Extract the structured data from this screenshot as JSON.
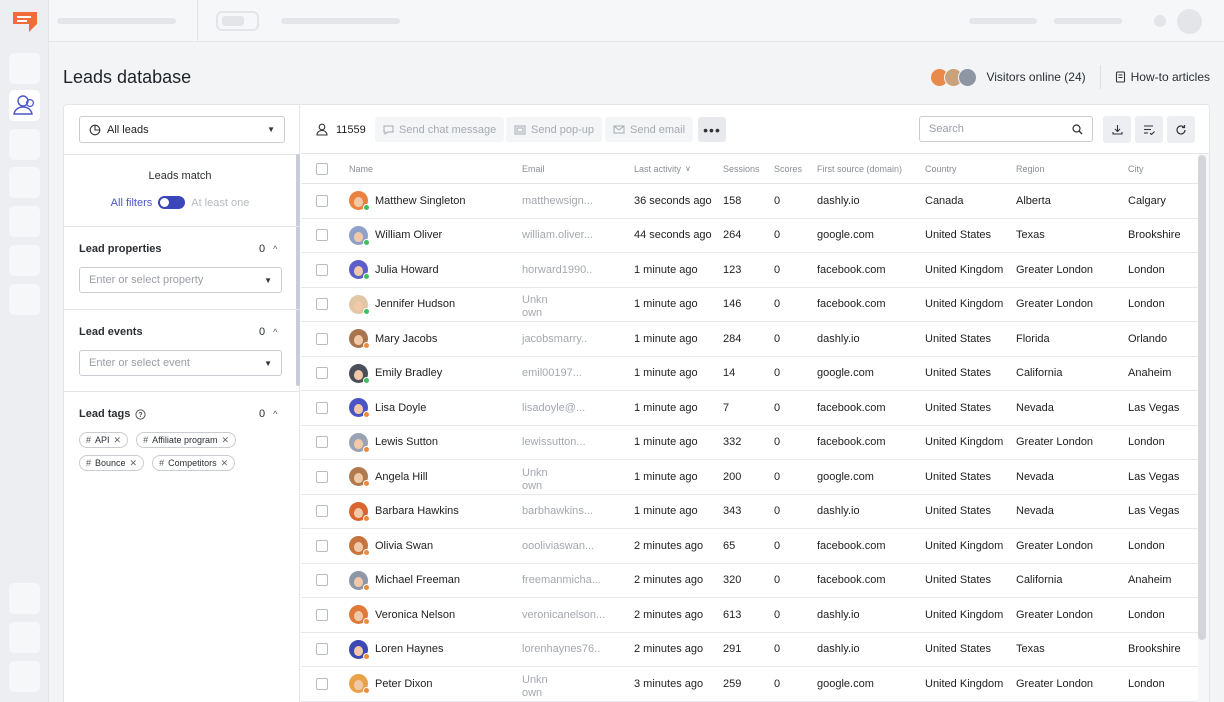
{
  "page": {
    "title": "Leads database"
  },
  "header": {
    "visitors_label": "Visitors online (24)",
    "howto_label": "How-to articles",
    "avatar_colors": [
      "#e98a4a",
      "#c9a27c",
      "#8f96a3"
    ]
  },
  "filters": {
    "leads_select": "All leads",
    "match_title": "Leads match",
    "all_filters": "All filters",
    "at_least_one": "At least one",
    "properties": {
      "title": "Lead properties",
      "count": "0",
      "placeholder": "Enter or select property"
    },
    "events": {
      "title": "Lead events",
      "count": "0",
      "placeholder": "Enter or select event"
    },
    "tags": {
      "title": "Lead tags",
      "count": "0",
      "items": [
        "API",
        "Affiliate program",
        "Bounce",
        "Competitors"
      ]
    }
  },
  "toolbar": {
    "count": "11559",
    "send_chat": "Send chat message",
    "send_popup": "Send pop-up",
    "send_email": "Send email",
    "more": "•••",
    "search_placeholder": "Search"
  },
  "table": {
    "columns": [
      "Name",
      "Email",
      "Last activity",
      "Sessions",
      "Scores",
      "First source (domain)",
      "Country",
      "Region",
      "City"
    ],
    "rows": [
      {
        "name": "Matthew Singleton",
        "email": "matthewsign...",
        "activity": "36 seconds ago",
        "sessions": "158",
        "scores": "0",
        "source": "dashly.io",
        "country": "Canada",
        "region": "Alberta",
        "city": "Calgary",
        "status": "#3cbf5c",
        "bg": "#e9833f"
      },
      {
        "name": "William Oliver",
        "email": "william.oliver...",
        "activity": "44 seconds ago",
        "sessions": "264",
        "scores": "0",
        "source": "google.com",
        "country": "United States",
        "region": "Texas",
        "city": "Brookshire",
        "status": "#3cbf5c",
        "bg": "#8fa0c9"
      },
      {
        "name": "Julia Howard",
        "email": "horward1990..",
        "activity": "1 minute ago",
        "sessions": "123",
        "scores": "0",
        "source": "facebook.com",
        "country": "United Kingdom",
        "region": "Greater London",
        "city": "London",
        "status": "#3cbf5c",
        "bg": "#5b5fc7"
      },
      {
        "name": "Jennifer Hudson",
        "email": "Unkn own",
        "activity": "1 minute ago",
        "sessions": "146",
        "scores": "0",
        "source": "facebook.com",
        "country": "United Kingdom",
        "region": "Greater London",
        "city": "London",
        "status": "#3cbf5c",
        "bg": "#e2c7a6"
      },
      {
        "name": "Mary Jacobs",
        "email": "jacobsmarry..",
        "activity": "1 minute ago",
        "sessions": "284",
        "scores": "0",
        "source": "dashly.io",
        "country": "United States",
        "region": "Florida",
        "city": "Orlando",
        "status": "#f08a3a",
        "bg": "#a8744d"
      },
      {
        "name": "Emily Bradley",
        "email": "emil00197...",
        "activity": "1 minute ago",
        "sessions": "14",
        "scores": "0",
        "source": "google.com",
        "country": "United States",
        "region": "California",
        "city": "Anaheim",
        "status": "#3cbf5c",
        "bg": "#4c4f5a"
      },
      {
        "name": "Lisa Doyle",
        "email": "lisadoyle@...",
        "activity": "1 minute ago",
        "sessions": "7",
        "scores": "0",
        "source": "facebook.com",
        "country": "United States",
        "region": "Nevada",
        "city": "Las Vegas",
        "status": "#f08a3a",
        "bg": "#4a54c4"
      },
      {
        "name": "Lewis Sutton",
        "email": "lewissutton...",
        "activity": "1 minute ago",
        "sessions": "332",
        "scores": "0",
        "source": "facebook.com",
        "country": "United Kingdom",
        "region": "Greater London",
        "city": "London",
        "status": "#f08a3a",
        "bg": "#9aa3b3"
      },
      {
        "name": "Angela Hill",
        "email": "Unkn own",
        "activity": "1 minute ago",
        "sessions": "200",
        "scores": "0",
        "source": "google.com",
        "country": "United States",
        "region": "Nevada",
        "city": "Las Vegas",
        "status": "#f08a3a",
        "bg": "#b07a4f"
      },
      {
        "name": "Barbara Hawkins",
        "email": "barbhawkins...",
        "activity": "1 minute ago",
        "sessions": "343",
        "scores": "0",
        "source": "dashly.io",
        "country": "United States",
        "region": "Nevada",
        "city": "Las Vegas",
        "status": "#f08a3a",
        "bg": "#d9652f"
      },
      {
        "name": "Olivia Swan",
        "email": "oooliviaswan...",
        "activity": "2 minutes ago",
        "sessions": "65",
        "scores": "0",
        "source": "facebook.com",
        "country": "United Kingdom",
        "region": "Greater London",
        "city": "London",
        "status": "#f08a3a",
        "bg": "#c7743e"
      },
      {
        "name": "Michael Freeman",
        "email": "freemanmicha...",
        "activity": "2 minutes ago",
        "sessions": "320",
        "scores": "0",
        "source": "facebook.com",
        "country": "United States",
        "region": "California",
        "city": "Anaheim",
        "status": "#f08a3a",
        "bg": "#8e97a8"
      },
      {
        "name": "Veronica Nelson",
        "email": "veronicanelson...",
        "activity": "2 minutes ago",
        "sessions": "613",
        "scores": "0",
        "source": "dashly.io",
        "country": "United Kingdom",
        "region": "Greater London",
        "city": "London",
        "status": "#f08a3a",
        "bg": "#e07a3a"
      },
      {
        "name": "Loren Haynes",
        "email": "lorenhaynes76..",
        "activity": "2 minutes ago",
        "sessions": "291",
        "scores": "0",
        "source": "dashly.io",
        "country": "United States",
        "region": "Texas",
        "city": "Brookshire",
        "status": "#f08a3a",
        "bg": "#3e48b5"
      },
      {
        "name": "Peter Dixon",
        "email": "Unkn own",
        "activity": "3 minutes ago",
        "sessions": "259",
        "scores": "0",
        "source": "google.com",
        "country": "United Kingdom",
        "region": "Greater London",
        "city": "London",
        "status": "#f08a3a",
        "bg": "#e8a24a"
      }
    ]
  }
}
